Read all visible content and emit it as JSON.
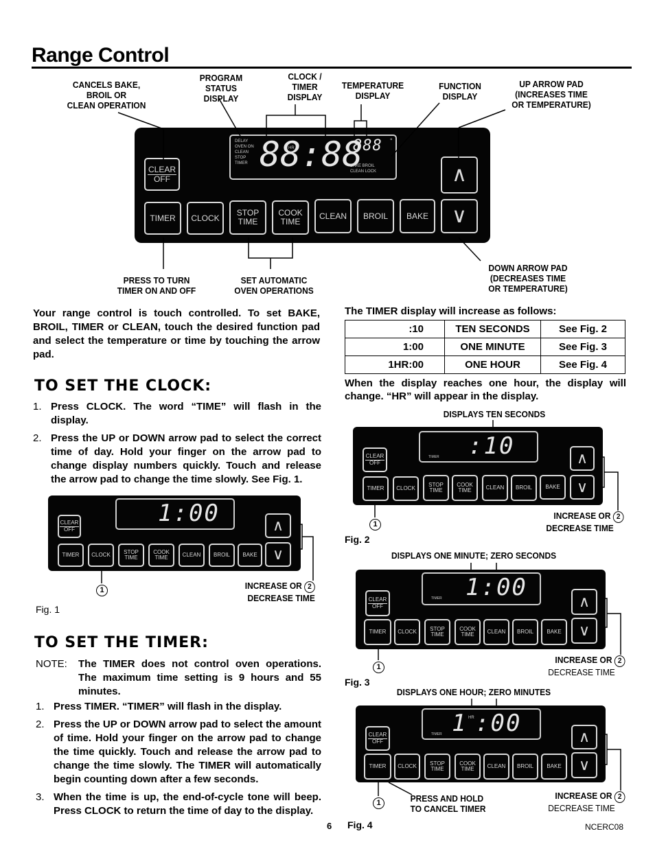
{
  "page": {
    "title": "Range Control",
    "page_number": "6",
    "doc_code": "NCERC08"
  },
  "main_diagram": {
    "callouts": {
      "cancels": [
        "CANCELS BAKE,",
        "BROIL OR",
        "CLEAN OPERATION"
      ],
      "program_status": [
        "PROGRAM",
        "STATUS",
        "DISPLAY"
      ],
      "clock_timer": [
        "CLOCK /",
        "TIMER",
        "DISPLAY"
      ],
      "temperature": [
        "TEMPERATURE",
        "DISPLAY"
      ],
      "function": [
        "FUNCTION",
        "DISPLAY"
      ],
      "up_arrow": [
        "UP ARROW PAD",
        "(INCREASES TIME",
        "OR TEMPERATURE)"
      ],
      "press_to_turn": [
        "PRESS TO TURN",
        "TIMER ON AND OFF"
      ],
      "set_automatic": [
        "SET AUTOMATIC",
        "OVEN OPERATIONS"
      ],
      "down_arrow": [
        "DOWN ARROW PAD",
        "(DECREASES TIME",
        "OR TEMPERATURE)"
      ]
    },
    "status_labels": [
      "DELAY",
      "OVEN ON",
      "CLEAN",
      "STOP",
      "TIMER"
    ],
    "clock_digits": "88:88",
    "hr_label": "HR",
    "temp_digits": "888",
    "degree": "°",
    "function_labels": [
      "BAKE  BROIL",
      "CLEAN LOCK"
    ]
  },
  "pads": {
    "clear_top": "CLEAR",
    "clear_bottom": "OFF",
    "timer": "TIMER",
    "clock": "CLOCK",
    "stop_1": "STOP",
    "stop_2": "TIME",
    "cook_1": "COOK",
    "cook_2": "TIME",
    "clean": "CLEAN",
    "broil": "BROIL",
    "bake": "BAKE",
    "up": "∧",
    "down": "∨"
  },
  "intro": "Your range control is touch controlled. To set BAKE, BROIL, TIMER or CLEAN, touch the desired function pad and select the temperature or time by touching the arrow pad.",
  "clock_section": {
    "heading": "TO SET THE CLOCK:",
    "steps": [
      {
        "num": "1.",
        "text": "Press CLOCK.  The word “TIME” will flash in the display."
      },
      {
        "num": "2.",
        "text": "Press the UP or DOWN arrow pad to select the correct time of day.  Hold your finger on the arrow pad to change display numbers quickly.  Touch and release the arrow pad to change the time slowly.  See Fig. 1."
      }
    ]
  },
  "timer_section": {
    "heading": "TO SET THE TIMER:",
    "note_label": "NOTE:",
    "note_text": "The TIMER does not control oven operations. The maximum time setting is 9 hours and 55 minutes.",
    "steps": [
      {
        "num": "1.",
        "text": "Press TIMER.  “TIMER” will flash in the display."
      },
      {
        "num": "2.",
        "text": "Press the UP or DOWN arrow pad to select the amount of time.  Hold your finger on the arrow pad to change the time quickly. Touch and release the arrow pad to change the time slowly.  The TIMER will automatically begin counting down after a few seconds."
      },
      {
        "num": "3.",
        "text": "When the time is up, the end-of-cycle tone will beep. Press CLOCK to return the time of day to the display."
      }
    ]
  },
  "timer_table": {
    "intro": "The TIMER display will increase as follows:",
    "rows": [
      [
        ":10",
        "TEN SECONDS",
        "See Fig. 2"
      ],
      [
        "1:00",
        "ONE MINUTE",
        "See Fig. 3"
      ],
      [
        "1HR:00",
        "ONE HOUR",
        "See Fig. 4"
      ]
    ],
    "after": "When the display reaches one hour, the display will change.  “HR” will appear in the display."
  },
  "figures": {
    "fig1": {
      "label": "Fig. 1",
      "display": "1:00",
      "step1": "1",
      "step2": "2",
      "caption": [
        "INCREASE OR",
        "DECREASE TIME"
      ]
    },
    "fig2": {
      "label": "Fig. 2",
      "heading": "DISPLAYS TEN SECONDS",
      "display": ":10",
      "small_label": "TIMER",
      "step1": "1",
      "step2": "2",
      "caption": [
        "INCREASE OR",
        "DECREASE TIME"
      ]
    },
    "fig3": {
      "label": "Fig. 3",
      "heading": "DISPLAYS ONE MINUTE; ZERO SECONDS",
      "display": "1:00",
      "small_label": "TIMER",
      "step1": "1",
      "step2": "2",
      "caption": [
        "INCREASE OR",
        "DECREASE TIME"
      ]
    },
    "fig4": {
      "label": "Fig. 4",
      "heading": "DISPLAYS ONE HOUR; ZERO MINUTES",
      "display_hour": "1",
      "display_min": ":00",
      "hr_label": "HR",
      "small_label": "TIMER",
      "step1": "1",
      "step2": "2",
      "caption": [
        "INCREASE OR",
        "DECREASE TIME"
      ],
      "cancel_caption": [
        "PRESS AND HOLD",
        "TO CANCEL TIMER"
      ]
    }
  }
}
